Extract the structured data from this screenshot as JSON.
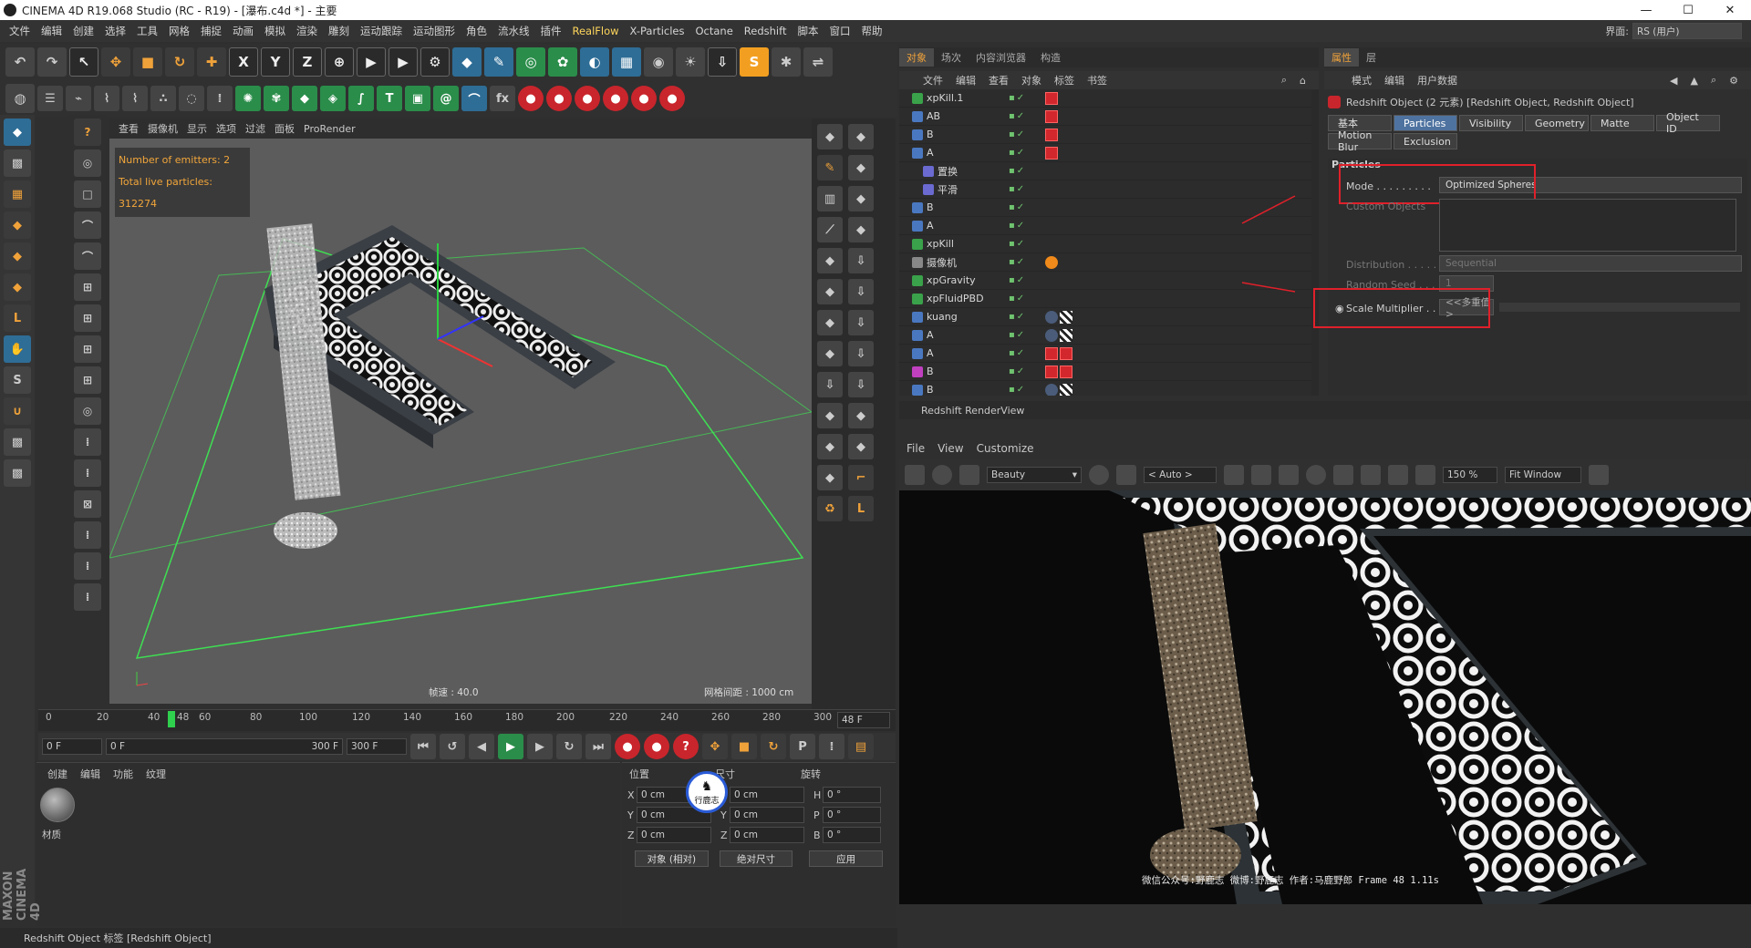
{
  "window": {
    "title": "CINEMA 4D R19.068 Studio (RC - R19) - [瀑布.c4d *] - 主要",
    "min": "—",
    "max": "☐",
    "close": "✕"
  },
  "menu": [
    "文件",
    "编辑",
    "创建",
    "选择",
    "工具",
    "网格",
    "捕捉",
    "动画",
    "模拟",
    "渲染",
    "雕刻",
    "运动跟踪",
    "运动图形",
    "角色",
    "流水线",
    "插件",
    "RealFlow",
    "X-Particles",
    "Octane",
    "Redshift",
    "脚本",
    "窗口",
    "帮助"
  ],
  "layout": {
    "label": "界面:",
    "value": "RS (用户)"
  },
  "viewport": {
    "menu": [
      "查看",
      "摄像机",
      "显示",
      "选项",
      "过滤",
      "面板",
      "ProRender"
    ],
    "info": [
      "Number of emitters: 2",
      "Total live particles: 312274"
    ],
    "speed": "帧速 : 40.0",
    "grid": "网格间距 : 1000 cm"
  },
  "timeline": {
    "ticks": [
      "0",
      "20",
      "40",
      "48",
      "60",
      "80",
      "100",
      "120",
      "140",
      "160",
      "180",
      "200",
      "220",
      "240",
      "260",
      "280",
      "300"
    ],
    "current": "48 F",
    "start": "0 F",
    "range_start": "0 F",
    "range_end": "300 F",
    "end": "300 F"
  },
  "material": {
    "menu": [
      "创建",
      "编辑",
      "功能",
      "纹理"
    ],
    "name": "材质"
  },
  "coords": {
    "headers": [
      "位置",
      "尺寸",
      "旋转"
    ],
    "rows": [
      {
        "a": "X",
        "p": "0 cm",
        "b": "X",
        "s": "0 cm",
        "c": "H",
        "r": "0 °"
      },
      {
        "a": "Y",
        "p": "0 cm",
        "b": "Y",
        "s": "0 cm",
        "c": "P",
        "r": "0 °"
      },
      {
        "a": "Z",
        "p": "0 cm",
        "b": "Z",
        "s": "0 cm",
        "c": "B",
        "r": "0 °"
      }
    ],
    "mode": "对象 (相对)",
    "size_mode": "绝对尺寸",
    "apply": "应用"
  },
  "badge": "行鹿志",
  "status": "Redshift Object 标签 [Redshift Object]",
  "object_manager": {
    "tabs": [
      "对象",
      "场次",
      "内容浏览器",
      "构造"
    ],
    "menu": [
      "文件",
      "编辑",
      "查看",
      "对象",
      "标签",
      "书签"
    ],
    "rows": [
      {
        "name": "xpKill.1",
        "indent": 0,
        "color": "#3aa24a",
        "tags": "r"
      },
      {
        "name": "AB",
        "indent": 0,
        "color": "#4a78c0",
        "tags": "r"
      },
      {
        "name": "B",
        "indent": 0,
        "color": "#4a78c0",
        "tags": "r"
      },
      {
        "name": "A",
        "indent": 0,
        "color": "#4a78c0",
        "tags": "r"
      },
      {
        "name": "置换",
        "indent": 1,
        "color": "#6a6ad0",
        "tags": ""
      },
      {
        "name": "平滑",
        "indent": 1,
        "color": "#6a6ad0",
        "tags": ""
      },
      {
        "name": "B",
        "indent": 0,
        "color": "#4a78c0",
        "tags": ""
      },
      {
        "name": "A",
        "indent": 0,
        "color": "#4a78c0",
        "tags": ""
      },
      {
        "name": "xpKill",
        "indent": 0,
        "color": "#3aa24a",
        "tags": ""
      },
      {
        "name": "摄像机",
        "indent": 0,
        "color": "#888888",
        "tags": "o"
      },
      {
        "name": "xpGravity",
        "indent": 0,
        "color": "#3aa24a",
        "tags": ""
      },
      {
        "name": "xpFluidPBD",
        "indent": 0,
        "color": "#3aa24a",
        "tags": ""
      },
      {
        "name": "kuang",
        "indent": 0,
        "color": "#4a78c0",
        "tags": "b"
      },
      {
        "name": "A",
        "indent": 0,
        "color": "#4a78c0",
        "tags": "b"
      },
      {
        "name": "A",
        "indent": 0,
        "color": "#4a78c0",
        "tags": "rr"
      },
      {
        "name": "B",
        "indent": 0,
        "color": "#c040c0",
        "tags": "rr"
      },
      {
        "name": "B",
        "indent": 0,
        "color": "#4a78c0",
        "tags": "b"
      }
    ]
  },
  "attributes": {
    "tabs": [
      "属性",
      "层"
    ],
    "menu": [
      "模式",
      "编辑",
      "用户数据"
    ],
    "title": "Redshift Object (2 元素) [Redshift Object, Redshift Object]",
    "subtabs": [
      "基本",
      "Particles",
      "Visibility",
      "Geometry",
      "Matte",
      "Object ID",
      "Motion Blur",
      "Exclusion"
    ],
    "section": "Particles",
    "mode_label": "Mode . . . . . . . . .",
    "mode_value": "Optimized Spheres",
    "custom_label": "Custom Objects",
    "dist_label": "Distribution . . . . .",
    "dist_value": "Sequential",
    "seed_label": "Random Seed . . . .",
    "seed_value": "1",
    "scale_label": "Scale Multiplier . . .",
    "scale_value": "<<多重值>"
  },
  "renderview": {
    "title": "Redshift RenderView",
    "menu": [
      "File",
      "View",
      "Customize"
    ],
    "aov": "Beauty",
    "auto": "< Auto >",
    "zoom": "150 %",
    "fit": "Fit Window",
    "caption": "微信公众号:野鹿志  微博:野鹿志  作者:马鹿野郎  Frame  48  1.11s"
  }
}
